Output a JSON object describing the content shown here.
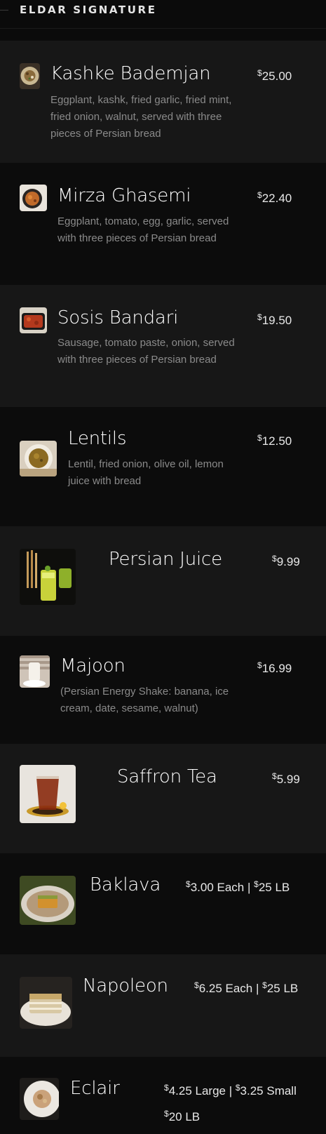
{
  "section": {
    "title": "ELDAR SIGNATURE"
  },
  "items": [
    {
      "name": "Kashke Bademjan",
      "description": "Eggplant, kashk, fried garlic, fried mint, fried onion, walnut, served with three pieces of Persian bread",
      "currency": "$",
      "price_main": "25.00",
      "icon": "kashke-bademjan-photo"
    },
    {
      "name": "Mirza Ghasemi",
      "description": "Eggplant, tomato, egg, garlic, served with three pieces of Persian bread",
      "currency": "$",
      "price_main": "22.40",
      "icon": "mirza-ghasemi-photo"
    },
    {
      "name": "Sosis Bandari",
      "description": "Sausage, tomato paste, onion, served with three pieces of Persian bread",
      "currency": "$",
      "price_main": "19.50",
      "icon": "sosis-bandari-photo"
    },
    {
      "name": "Lentils",
      "description": "Lentil, fried onion, olive oil, lemon juice with bread",
      "currency": "$",
      "price_main": "12.50",
      "icon": "lentils-photo"
    },
    {
      "name": "Persian Juice",
      "description": "",
      "currency": "$",
      "price_main": "9.99",
      "icon": "persian-juice-photo"
    },
    {
      "name": "Majoon",
      "description": "(Persian Energy Shake: banana, ice cream, date, sesame, walnut)",
      "currency": "$",
      "price_main": "16.99",
      "icon": "majoon-photo"
    },
    {
      "name": "Saffron Tea",
      "description": "",
      "currency": "$",
      "price_main": "5.99",
      "icon": "saffron-tea-photo"
    },
    {
      "name": "Baklava",
      "description": "",
      "currency": "$",
      "price_main": "3.00 Each |",
      "currency2": "$",
      "price_second": "25 LB",
      "icon": "baklava-photo"
    },
    {
      "name": "Napoleon",
      "description": "",
      "currency": "$",
      "price_main": "6.25 Each |",
      "currency2": "$",
      "price_second": "25 LB",
      "icon": "napoleon-photo"
    },
    {
      "name": "Eclair",
      "description": "",
      "currency": "$",
      "price_main": "4.25 Large |",
      "currency2": "$",
      "price_second": "3.25 Small",
      "currency3": "$",
      "price_third": "20 LB",
      "icon": "eclair-photo"
    }
  ]
}
